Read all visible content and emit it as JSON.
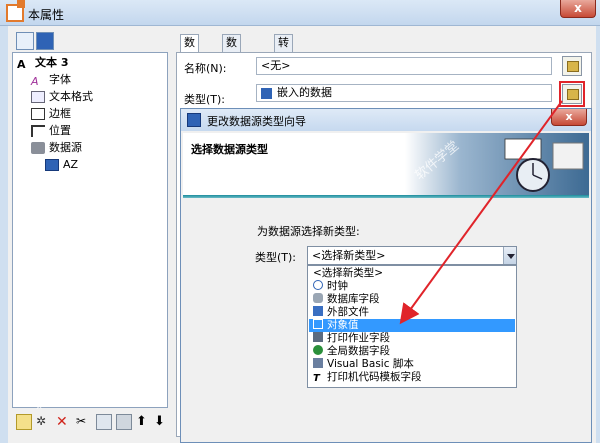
{
  "window": {
    "title": "本属性",
    "close": "x"
  },
  "tree": {
    "items": [
      {
        "label": "文本 3",
        "icon": "text-a-icon",
        "bold": true
      },
      {
        "label": "字体",
        "icon": "font-icon"
      },
      {
        "label": "文本格式",
        "icon": "text-format-icon"
      },
      {
        "label": "边框",
        "icon": "border-icon"
      },
      {
        "label": "位置",
        "icon": "position-icon"
      },
      {
        "label": "数据源",
        "icon": "datasource-icon"
      },
      {
        "label": "AZ",
        "icon": "embedded-data-icon"
      }
    ]
  },
  "tabs": [
    "数据源",
    "数据类型",
    "转换"
  ],
  "datasource": {
    "name_label": "名称(N):",
    "name_value": "<无>",
    "type_label": "类型(T):",
    "type_value": "嵌入的数据"
  },
  "wizard": {
    "title": "更改数据源类型向导",
    "close": "x",
    "heading": "选择数据源类型",
    "prompt": "为数据源选择新类型:",
    "type_label": "类型(T):",
    "selected": "<选择新类型>",
    "options": [
      {
        "label": "<选择新类型>",
        "icon": ""
      },
      {
        "label": "时钟",
        "icon": "clock-icon"
      },
      {
        "label": "数据库字段",
        "icon": "database-icon"
      },
      {
        "label": "外部文件",
        "icon": "file-icon"
      },
      {
        "label": "对象值",
        "icon": "object-value-icon",
        "selected": true
      },
      {
        "label": "打印作业字段",
        "icon": "print-job-icon"
      },
      {
        "label": "全局数据字段",
        "icon": "globe-icon"
      },
      {
        "label": "Visual Basic 脚本",
        "icon": "vb-script-icon"
      },
      {
        "label": "打印机代码模板字段",
        "icon": "printer-code-icon"
      }
    ]
  },
  "watermark": "软件学堂",
  "colors": {
    "highlight": "#3399ff",
    "annotation": "#e0242a",
    "title_bar": "#c3d7ee"
  }
}
